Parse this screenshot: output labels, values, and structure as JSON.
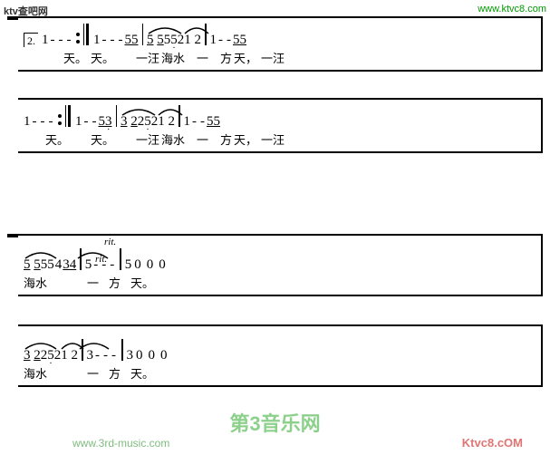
{
  "watermarks": {
    "top_left": "ktv查吧网",
    "top_right": "www.ktvc8.com",
    "bottom_center": "第3音乐网",
    "bottom_left": "www.3rd-music.com",
    "bottom_right": "Ktvc8.cOM"
  },
  "section1": {
    "row1_notes": "1 - - - | 1 - - - | 1 - - 5 5 | 5 5 5 5 2 1 2 | 1 - - 5 5",
    "row1_lyrics": "天。 天。 一汪 海水 一 方 天， 一汪",
    "row2_notes": "1 - - - | 1 - - 5 3 | 3 2 2 5 2 1 2 | 1 - - 5 5",
    "row2_lyrics": "天。 天。 一汪 海水 一 方 天， 一汪"
  },
  "section2": {
    "row1_notes": "5 5 5 5 4 3 4 | 5 - - - | 5 0 0 0",
    "row1_lyrics": "海水 一 方 天。",
    "row2_notes": "3 2 2 5 2 1 2 | 3 - - - | 3 0 0 0",
    "row2_lyrics": "海水 一 方 天。",
    "rit": "rit."
  }
}
